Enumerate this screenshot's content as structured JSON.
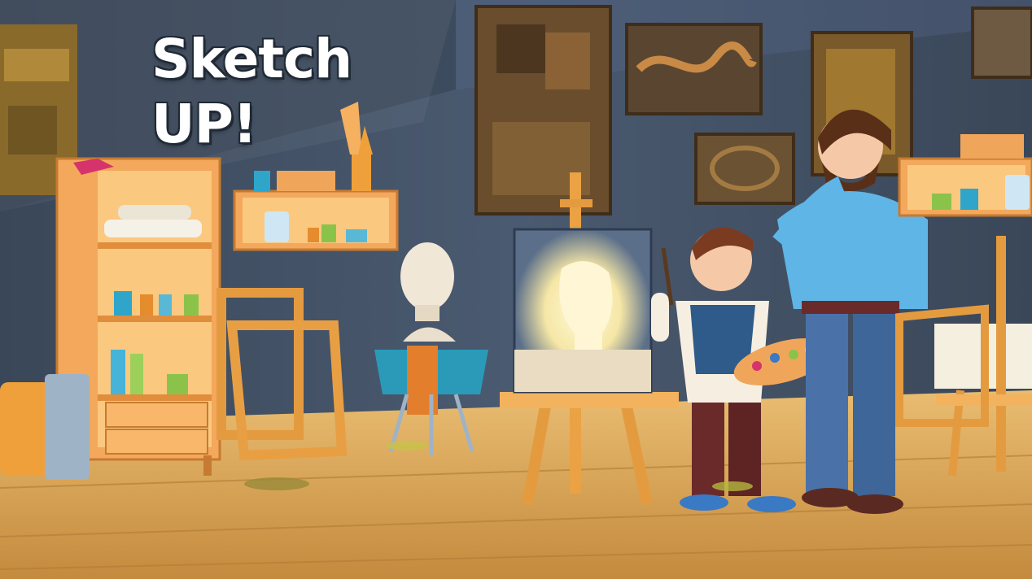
{
  "title": {
    "line1": "Sketch",
    "line2": "UP!"
  },
  "colors": {
    "wall": "#3f4d60",
    "floor": "#d8a75a",
    "shelf": "#f0a65a",
    "canvas_glow": "#fff3c4",
    "teacher_shirt": "#5fb5e6",
    "boy_vest": "#2e5b8a",
    "title_text": "#ffffff"
  },
  "icons": [
    "bookcase-icon",
    "easel-icon",
    "palette-icon",
    "plaster-bust-icon",
    "paintbrush-icon",
    "picture-frame-icon"
  ]
}
